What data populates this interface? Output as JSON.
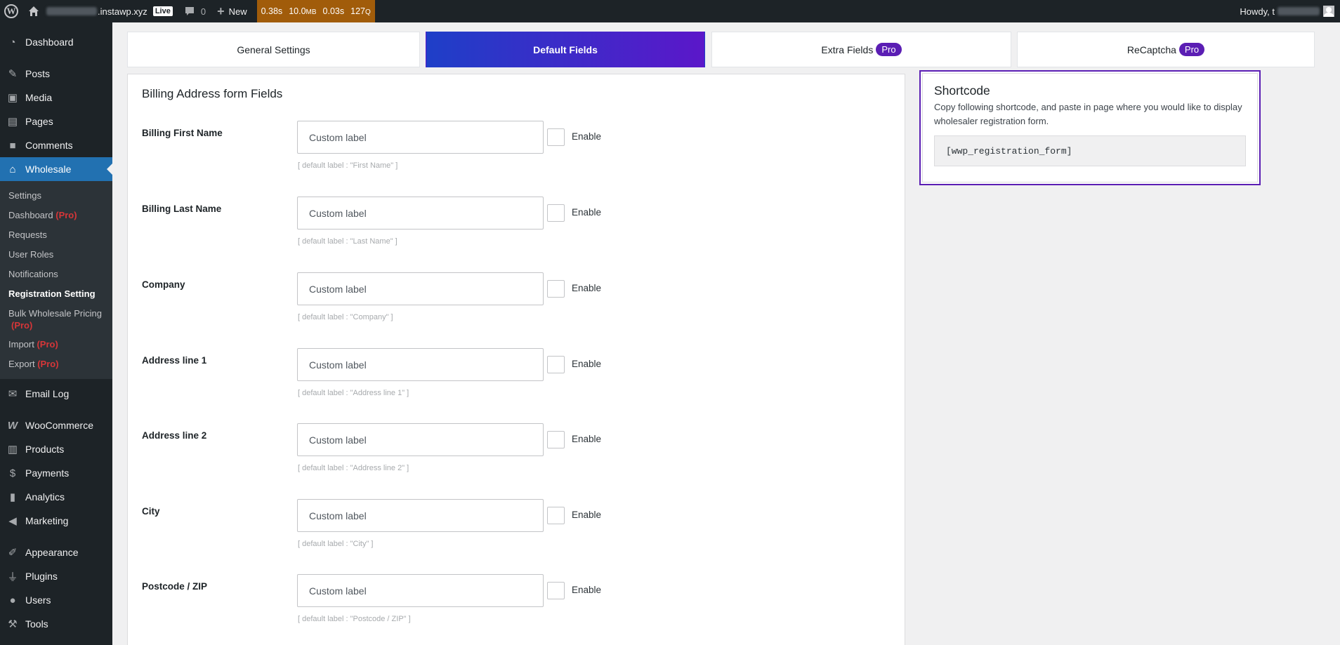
{
  "admin_bar": {
    "site_suffix": ".instawp.xyz",
    "live_label": "Live",
    "comments_count": "0",
    "new_label": "New",
    "qm_time": "0.38s",
    "qm_memory_value": "10.0",
    "qm_memory_unit": "MB",
    "qm_db_time": "0.03s",
    "qm_queries_value": "127",
    "qm_queries_unit": "Q",
    "howdy_prefix": "Howdy, t"
  },
  "sidebar": {
    "items_top": [
      {
        "label": "Dashboard",
        "icon": "dashboard-icon"
      },
      {
        "label": "Posts",
        "icon": "pin-icon"
      },
      {
        "label": "Media",
        "icon": "media-icon"
      },
      {
        "label": "Pages",
        "icon": "pages-icon"
      },
      {
        "label": "Comments",
        "icon": "comment-icon"
      },
      {
        "label": "Wholesale",
        "icon": "store-icon"
      }
    ],
    "submenu": [
      {
        "label": "Settings",
        "pro": ""
      },
      {
        "label": "Dashboard",
        "pro": "(Pro)"
      },
      {
        "label": "Requests",
        "pro": ""
      },
      {
        "label": "User Roles",
        "pro": ""
      },
      {
        "label": "Notifications",
        "pro": ""
      },
      {
        "label": "Registration Setting",
        "pro": ""
      },
      {
        "label": "Bulk Wholesale Pricing",
        "pro": "(Pro)"
      },
      {
        "label": "Import",
        "pro": "(Pro)"
      },
      {
        "label": "Export",
        "pro": "(Pro)"
      }
    ],
    "items_bottom": [
      {
        "label": "Email Log",
        "icon": "email-icon"
      },
      {
        "label": "WooCommerce",
        "icon": "woocommerce-icon"
      },
      {
        "label": "Products",
        "icon": "archive-icon"
      },
      {
        "label": "Payments",
        "icon": "dollar-icon"
      },
      {
        "label": "Analytics",
        "icon": "bar-chart-icon"
      },
      {
        "label": "Marketing",
        "icon": "megaphone-icon"
      },
      {
        "label": "Appearance",
        "icon": "brush-icon"
      },
      {
        "label": "Plugins",
        "icon": "plugin-icon"
      },
      {
        "label": "Users",
        "icon": "user-icon"
      },
      {
        "label": "Tools",
        "icon": "wrench-icon"
      }
    ]
  },
  "tabs": [
    {
      "label": "General Settings",
      "badge": ""
    },
    {
      "label": "Default Fields",
      "badge": ""
    },
    {
      "label": "Extra Fields",
      "badge": "Pro"
    },
    {
      "label": "ReCaptcha",
      "badge": "Pro"
    }
  ],
  "main": {
    "title": "Billing Address form Fields",
    "fields": [
      {
        "label": "Billing First Name",
        "placeholder": "Custom label",
        "enable": "Enable",
        "hint": "[ default label : \"First Name\" ]"
      },
      {
        "label": "Billing Last Name",
        "placeholder": "Custom label",
        "enable": "Enable",
        "hint": "[ default label : \"Last Name\" ]"
      },
      {
        "label": "Company",
        "placeholder": "Custom label",
        "enable": "Enable",
        "hint": "[ default label : \"Company\" ]"
      },
      {
        "label": "Address line 1",
        "placeholder": "Custom label",
        "enable": "Enable",
        "hint": "[ default label : \"Address line 1\" ]"
      },
      {
        "label": "Address line 2",
        "placeholder": "Custom label",
        "enable": "Enable",
        "hint": "[ default label : \"Address line 2\" ]"
      },
      {
        "label": "City",
        "placeholder": "Custom label",
        "enable": "Enable",
        "hint": "[ default label : \"City\" ]"
      },
      {
        "label": "Postcode / ZIP",
        "placeholder": "Custom label",
        "enable": "Enable",
        "hint": "[ default label : \"Postcode / ZIP\" ]"
      }
    ]
  },
  "shortcode": {
    "title": "Shortcode",
    "description": "Copy following shortcode, and paste in page where you would like to display wholesaler registration form.",
    "code": "[wwp_registration_form]"
  },
  "colors": {
    "sidebar_bg": "#1d2327",
    "active_menu": "#2271b1",
    "tab_gradient_start": "#1e3fc8",
    "tab_gradient_end": "#5b17c9",
    "pro_badge": "#5b1eb4",
    "pro_text": "#d63638",
    "query_monitor": "#a15c0a"
  }
}
